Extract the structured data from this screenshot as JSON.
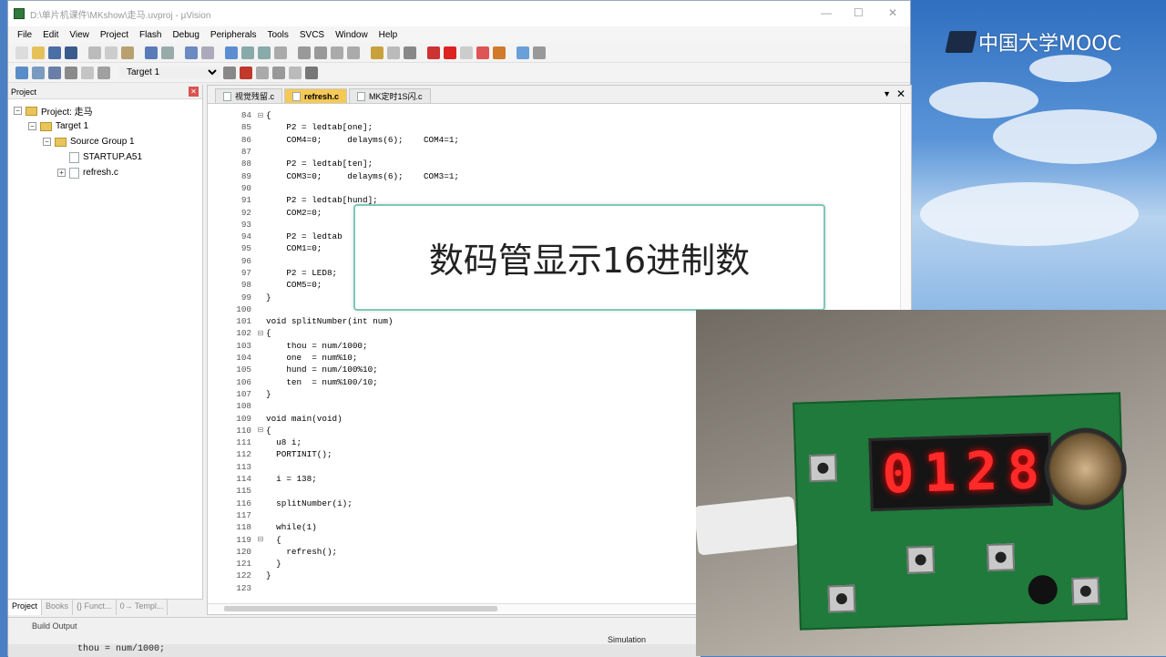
{
  "window": {
    "title": "D:\\单片机课件\\MKshow\\走马.uvproj - µVision"
  },
  "menu": [
    "File",
    "Edit",
    "View",
    "Project",
    "Flash",
    "Debug",
    "Peripherals",
    "Tools",
    "SVCS",
    "Window",
    "Help"
  ],
  "toolbar2": {
    "target": "Target 1"
  },
  "project_pane": {
    "title": "Project",
    "tree": [
      {
        "label": "Project: 走马",
        "level": 0,
        "toggle": "−",
        "icon": "project"
      },
      {
        "label": "Target 1",
        "level": 1,
        "toggle": "−",
        "icon": "folder"
      },
      {
        "label": "Source Group 1",
        "level": 2,
        "toggle": "−",
        "icon": "folder"
      },
      {
        "label": "STARTUP.A51",
        "level": 3,
        "toggle": "",
        "icon": "file"
      },
      {
        "label": "refresh.c",
        "level": 3,
        "toggle": "+",
        "icon": "file"
      }
    ],
    "tabs": [
      "Project",
      "Books",
      "{} Funct...",
      "0→ Templ..."
    ]
  },
  "editor": {
    "tabs": [
      {
        "label": "视觉残留.c",
        "active": false
      },
      {
        "label": "refresh.c",
        "active": true
      },
      {
        "label": "MK定时1S闪.c",
        "active": false
      }
    ],
    "lines": [
      {
        "n": "84",
        "fold": "⊟",
        "text": "{"
      },
      {
        "n": "85",
        "fold": "",
        "text": "    P2 = ledtab[one];"
      },
      {
        "n": "86",
        "fold": "",
        "text": "    COM4=0;     delayms(6);    COM4=1;"
      },
      {
        "n": "87",
        "fold": "",
        "text": ""
      },
      {
        "n": "88",
        "fold": "",
        "text": "    P2 = ledtab[ten];"
      },
      {
        "n": "89",
        "fold": "",
        "text": "    COM3=0;     delayms(6);    COM3=1;"
      },
      {
        "n": "90",
        "fold": "",
        "text": ""
      },
      {
        "n": "91",
        "fold": "",
        "text": "    P2 = ledtab[hund];"
      },
      {
        "n": "92",
        "fold": "",
        "text": "    COM2=0;"
      },
      {
        "n": "93",
        "fold": "",
        "text": ""
      },
      {
        "n": "94",
        "fold": "",
        "text": "    P2 = ledtab"
      },
      {
        "n": "95",
        "fold": "",
        "text": "    COM1=0;"
      },
      {
        "n": "96",
        "fold": "",
        "text": ""
      },
      {
        "n": "97",
        "fold": "",
        "text": "    P2 = LED8;"
      },
      {
        "n": "98",
        "fold": "",
        "text": "    COM5=0;"
      },
      {
        "n": "99",
        "fold": "",
        "text": "}"
      },
      {
        "n": "100",
        "fold": "",
        "text": ""
      },
      {
        "n": "101",
        "fold": "",
        "text": "void splitNumber(int num)"
      },
      {
        "n": "102",
        "fold": "⊟",
        "text": "{"
      },
      {
        "n": "103",
        "fold": "",
        "text": "    thou = num/1000;"
      },
      {
        "n": "104",
        "fold": "",
        "text": "    one  = num%10;"
      },
      {
        "n": "105",
        "fold": "",
        "text": "    hund = num/100%10;"
      },
      {
        "n": "106",
        "fold": "",
        "text": "    ten  = num%100/10;"
      },
      {
        "n": "107",
        "fold": "",
        "text": "}"
      },
      {
        "n": "108",
        "fold": "",
        "text": ""
      },
      {
        "n": "109",
        "fold": "",
        "text": "void main(void)"
      },
      {
        "n": "110",
        "fold": "⊟",
        "text": "{"
      },
      {
        "n": "111",
        "fold": "",
        "text": "  u8 i;"
      },
      {
        "n": "112",
        "fold": "",
        "text": "  PORTINIT();"
      },
      {
        "n": "113",
        "fold": "",
        "text": ""
      },
      {
        "n": "114",
        "fold": "",
        "text": "  i = 138;"
      },
      {
        "n": "115",
        "fold": "",
        "text": ""
      },
      {
        "n": "116",
        "fold": "",
        "text": "  splitNumber(i);"
      },
      {
        "n": "117",
        "fold": "",
        "text": ""
      },
      {
        "n": "118",
        "fold": "",
        "text": "  while(1)"
      },
      {
        "n": "119",
        "fold": "⊟",
        "text": "  {"
      },
      {
        "n": "120",
        "fold": "",
        "text": "    refresh();"
      },
      {
        "n": "121",
        "fold": "",
        "text": "  }"
      },
      {
        "n": "122",
        "fold": "",
        "text": "}"
      },
      {
        "n": "123",
        "fold": "",
        "text": ""
      }
    ]
  },
  "build_output": {
    "tab": "Build Output",
    "line": "thou = num/1000;"
  },
  "statusbar": {
    "mode": "Simulation"
  },
  "overlay": {
    "caption": "数码管显示16进制数"
  },
  "watermark": {
    "brand": "中国大学MOOC"
  },
  "board": {
    "display": [
      "0",
      "1",
      "2",
      "8"
    ]
  }
}
